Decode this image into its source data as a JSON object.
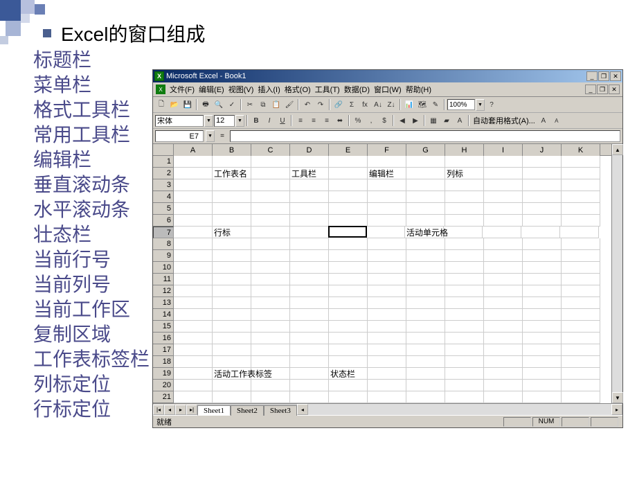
{
  "heading": "Excel的窗口组成",
  "terms": [
    "标题栏",
    "菜单栏",
    "格式工具栏",
    "常用工具栏",
    "编辑栏",
    "垂直滚动条",
    "水平滚动条",
    "壮态栏",
    "当前行号",
    "当前列号",
    "当前工作区",
    "复制区域",
    "工作表标签栏",
    "列标定位",
    "行标定位"
  ],
  "excel": {
    "title": "Microsoft Excel - Book1",
    "menu": [
      "文件(F)",
      "编辑(E)",
      "视图(V)",
      "插入(I)",
      "格式(O)",
      "工具(T)",
      "数据(D)",
      "窗口(W)",
      "帮助(H)"
    ],
    "std_icons": [
      "new",
      "open",
      "save",
      "sep",
      "print",
      "preview",
      "spell",
      "sep",
      "cut",
      "copy",
      "paste",
      "format-painter",
      "sep",
      "undo",
      "redo",
      "sep",
      "link",
      "sum",
      "fx",
      "sort-asc",
      "sort-desc",
      "sep",
      "chart",
      "map",
      "drawing"
    ],
    "zoom": "100%",
    "font": "宋体",
    "size": "12",
    "fmt_icons": [
      "bold",
      "italic",
      "underline",
      "sep",
      "align-left",
      "align-center",
      "align-right",
      "merge",
      "sep",
      "percent",
      "comma",
      "currency",
      "sep",
      "indent-dec",
      "indent-inc",
      "sep",
      "border",
      "fill",
      "font-color"
    ],
    "autoformat": "自动套用格式(A)...",
    "namebox": "E7",
    "columns": [
      "A",
      "B",
      "C",
      "D",
      "E",
      "F",
      "G",
      "H",
      "I",
      "J",
      "K"
    ],
    "row_count": 21,
    "active_row": 7,
    "active_col": 5,
    "cell_labels": {
      "r2cB": "工作表名",
      "r2cD": "工具栏",
      "r2cF": "编辑栏",
      "r2cH": "列标",
      "r7cB": "行标",
      "r7cG": "活动单元格",
      "r19cB": "活动工作表标签",
      "r19cE": "状态栏"
    },
    "sheets": [
      "Sheet1",
      "Sheet2",
      "Sheet3"
    ],
    "status": "就绪",
    "num_indicator": "NUM"
  }
}
